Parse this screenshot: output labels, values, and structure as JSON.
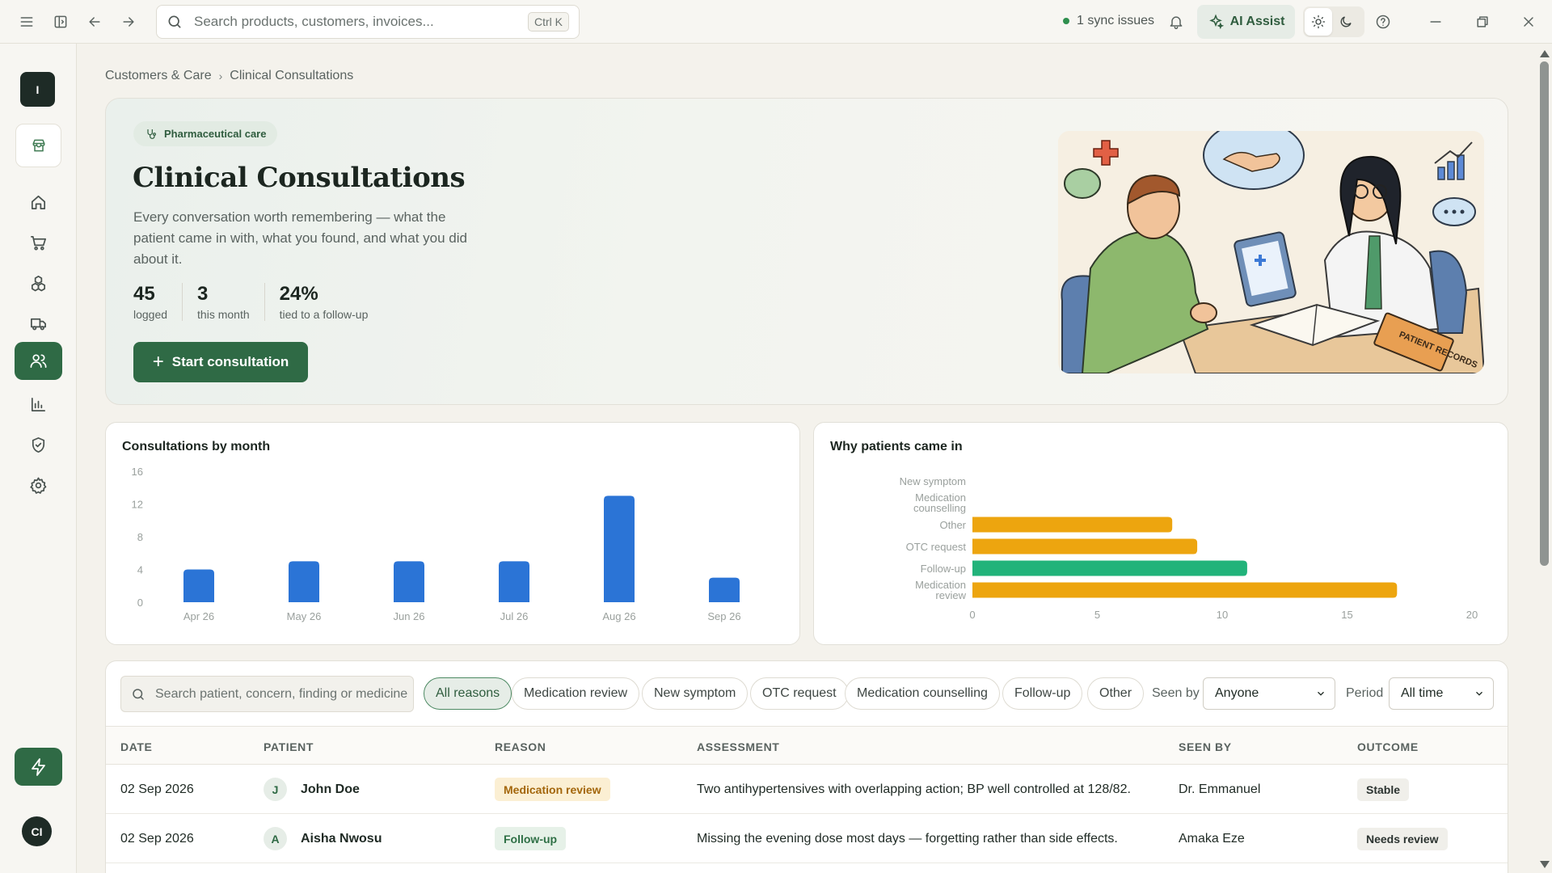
{
  "topbar": {
    "search_placeholder": "Search products, customers, invoices...",
    "search_shortcut": "Ctrl K",
    "sync_status": "1 sync issues",
    "ai_assist_label": "AI Assist"
  },
  "sidebar": {
    "org_initial": "I",
    "user_initials": "CI",
    "items": [
      {
        "name": "home",
        "icon": "home-icon"
      },
      {
        "name": "sales",
        "icon": "cart-icon"
      },
      {
        "name": "inventory",
        "icon": "boxes-icon"
      },
      {
        "name": "deliveries",
        "icon": "truck-icon"
      },
      {
        "name": "customers",
        "icon": "users-icon",
        "active": true
      },
      {
        "name": "reports",
        "icon": "bar-chart-icon"
      },
      {
        "name": "compliance",
        "icon": "shield-check-icon"
      },
      {
        "name": "settings",
        "icon": "gear-icon"
      }
    ]
  },
  "breadcrumb": {
    "parent": "Customers & Care",
    "current": "Clinical Consultations"
  },
  "hero": {
    "chip": "Pharmaceutical care",
    "title": "Clinical Consultations",
    "description": "Every conversation worth remembering — what the patient came in with, what you found, and what you did about it.",
    "stats": [
      {
        "value": "45",
        "label": "logged"
      },
      {
        "value": "3",
        "label": "this month"
      },
      {
        "value": "24%",
        "label": "tied to a follow-up"
      }
    ],
    "start_button": "Start consultation",
    "illustration_text": "PATIENT RECORDS"
  },
  "colors": {
    "accent": "#2f6a45",
    "bar_blue": "#2b74d6",
    "bar_amber": "#eda50f",
    "bar_green": "#21b37a"
  },
  "chart_data": [
    {
      "type": "bar",
      "title": "Consultations by month",
      "categories": [
        "Apr 26",
        "May 26",
        "Jun 26",
        "Jul 26",
        "Aug 26",
        "Sep 26"
      ],
      "values": [
        4,
        5,
        5,
        5,
        13,
        3
      ],
      "ylim": [
        0,
        16
      ],
      "yticks": [
        0,
        4,
        8,
        12,
        16
      ]
    },
    {
      "type": "bar",
      "orientation": "horizontal",
      "title": "Why patients came in",
      "categories": [
        "New symptom",
        "Medication counselling",
        "Other",
        "OTC request",
        "Follow-up",
        "Medication review"
      ],
      "values": [
        0,
        0,
        8,
        9,
        11,
        17
      ],
      "highlight": "Follow-up",
      "xlim": [
        0,
        20
      ],
      "xticks": [
        0,
        5,
        10,
        15,
        20
      ]
    }
  ],
  "filters": {
    "search_placeholder": "Search patient, concern, finding or medicine",
    "reasons": [
      "All reasons",
      "Medication review",
      "New symptom",
      "OTC request",
      "Medication counselling",
      "Follow-up",
      "Other"
    ],
    "seen_by_label": "Seen by",
    "seen_by_value": "Anyone",
    "period_label": "Period",
    "period_value": "All time"
  },
  "table": {
    "headers": [
      "DATE",
      "PATIENT",
      "REASON",
      "ASSESSMENT",
      "SEEN BY",
      "OUTCOME"
    ],
    "rows": [
      {
        "date": "02 Sep 2026",
        "initial": "J",
        "patient": "John Doe",
        "reason": "Medication review",
        "assessment": "Two antihypertensives with overlapping action; BP well controlled at 128/82.",
        "seen_by": "Dr. Emmanuel",
        "outcome": "Stable"
      },
      {
        "date": "02 Sep 2026",
        "initial": "A",
        "patient": "Aisha Nwosu",
        "reason": "Follow-up",
        "assessment": "Missing the evening dose most days — forgetting rather than side effects.",
        "seen_by": "Amaka Eze",
        "outcome": "Needs review"
      }
    ]
  }
}
